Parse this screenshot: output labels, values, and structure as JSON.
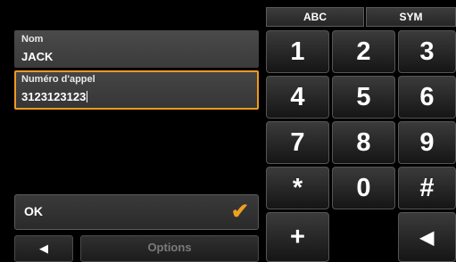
{
  "fields": {
    "name_label": "Nom",
    "name_value": "JACK",
    "number_label": "Numéro d'appel",
    "number_value": "3123123123"
  },
  "buttons": {
    "ok_label": "OK",
    "check_icon": "✔",
    "back_icon": "◀",
    "options_label": "Options"
  },
  "keypad": {
    "tabs": [
      "ABC",
      "SYM"
    ],
    "keys": [
      "1",
      "2",
      "3",
      "4",
      "5",
      "6",
      "7",
      "8",
      "9",
      "*",
      "0",
      "#",
      "+",
      "",
      ""
    ],
    "backspace_icon": "◀"
  },
  "colors": {
    "accent": "#f09a1e",
    "background": "#000000"
  }
}
